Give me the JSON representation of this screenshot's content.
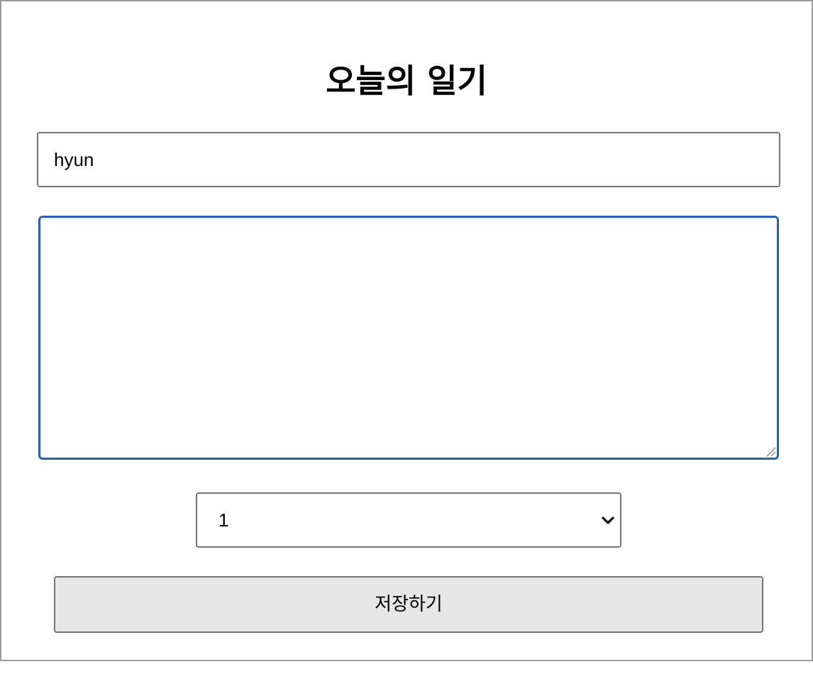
{
  "page": {
    "title": "오늘의 일기"
  },
  "author": {
    "value": "hyun"
  },
  "content": {
    "value": ""
  },
  "emotion": {
    "selected": "1"
  },
  "save_button": {
    "label": "저장하기"
  },
  "colors": {
    "focus_border": "#2860c4",
    "button_bg": "#e6e6e6",
    "border": "#767676"
  },
  "icons": {
    "select_arrow": "chevron-down-icon",
    "resize": "resize-grip-icon"
  }
}
